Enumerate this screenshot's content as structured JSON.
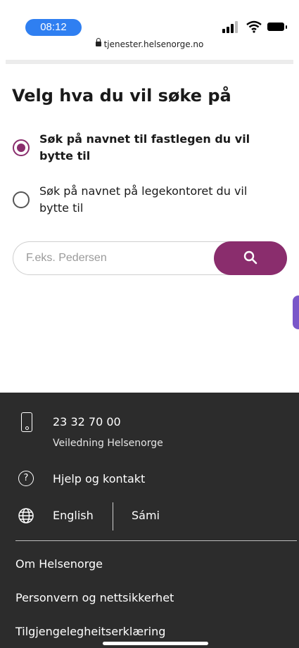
{
  "status_bar": {
    "time": "08:12",
    "url": "tjenester.helsenorge.no",
    "icons": [
      "signal-icon",
      "wifi-icon",
      "battery-icon",
      "lock-icon"
    ]
  },
  "main": {
    "title": "Velg hva du vil søke på",
    "options": [
      {
        "label": "Søk på navnet til fastlegen du vil bytte til",
        "selected": true
      },
      {
        "label": "Søk på navnet på legekontoret du vil bytte til",
        "selected": false
      }
    ],
    "search": {
      "placeholder": "F.eks. Pedersen",
      "value": "",
      "button_icon": "search-icon"
    }
  },
  "footer": {
    "phone_number": "23 32 70 00",
    "phone_description": "Veiledning Helsenorge",
    "help_label": "Hjelp og kontakt",
    "languages": [
      "English",
      "Sámi"
    ],
    "links": [
      "Om Helsenorge",
      "Personvern og nettsikkerhet",
      "Tilgjengelegheitserklæring"
    ]
  },
  "colors": {
    "accent": "#8a2d6d",
    "time_pill": "#2f7ff1",
    "footer_bg": "#2c2c2c",
    "side_tab": "#7a57c9"
  }
}
